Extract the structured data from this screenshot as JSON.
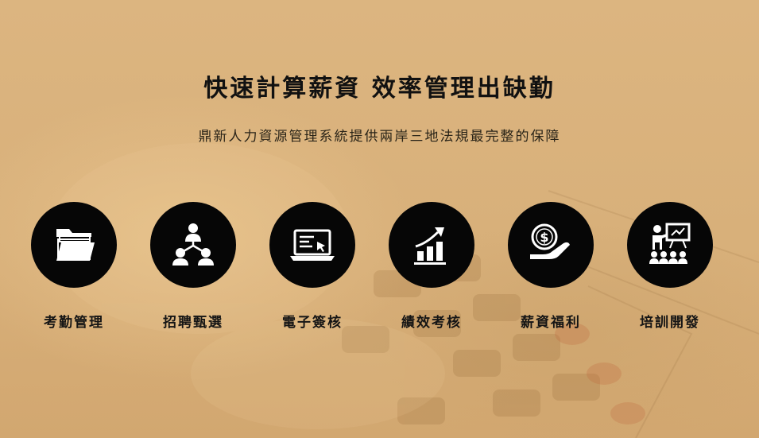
{
  "hero": {
    "title": "快速計算薪資 效率管理出缺勤",
    "subtitle": "鼎新人力資源管理系統提供兩岸三地法規最完整的保障"
  },
  "features": [
    {
      "label": "考勤管理",
      "icon": "folder-icon"
    },
    {
      "label": "招聘甄選",
      "icon": "org-chart-icon"
    },
    {
      "label": "電子簽核",
      "icon": "laptop-icon"
    },
    {
      "label": "績效考核",
      "icon": "growth-chart-icon"
    },
    {
      "label": "薪資福利",
      "icon": "dollar-hand-icon"
    },
    {
      "label": "培訓開發",
      "icon": "training-icon"
    }
  ],
  "colors": {
    "background": "#d9b27c",
    "circle": "#060606",
    "icon": "#ffffff",
    "text": "#111111"
  }
}
